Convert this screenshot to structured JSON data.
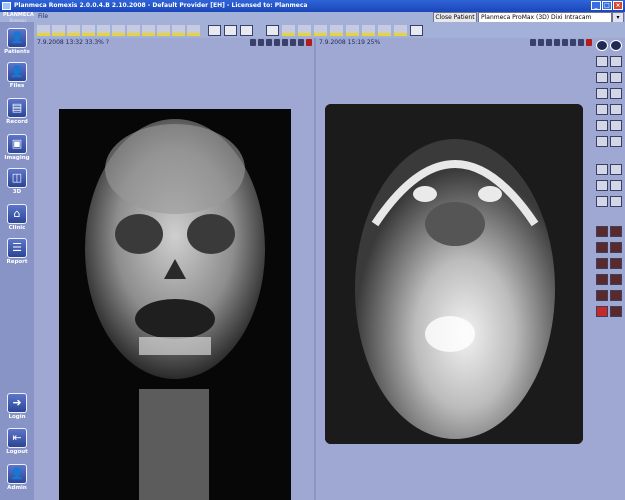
{
  "window": {
    "title": "Planmeca Romexis 2.0.0.4.B 2.10.2008 - Default Provider [EH] - Licensed to: Planmeca"
  },
  "menu": {
    "file_label": "File"
  },
  "brand": {
    "line1": "PLANMECA",
    "line2": "Romexis"
  },
  "patient_bar": {
    "close_patient_label": "Close Patient",
    "device_selected": "Planmeca ProMax (3D) Dixi Intracam"
  },
  "nav": {
    "items": [
      {
        "label": "Patients",
        "icon": "patients-icon"
      },
      {
        "label": "Files",
        "icon": "files-icon"
      },
      {
        "label": "Record",
        "icon": "record-icon"
      },
      {
        "label": "Imaging",
        "icon": "imaging-icon"
      },
      {
        "label": "3D",
        "icon": "3d-icon"
      },
      {
        "label": "Clinic",
        "icon": "clinic-icon"
      },
      {
        "label": "Report",
        "icon": "report-icon"
      },
      {
        "label": "Login",
        "icon": "login-icon"
      },
      {
        "label": "Logout",
        "icon": "logout-icon"
      },
      {
        "label": "Admin",
        "icon": "admin-icon"
      }
    ]
  },
  "viewers": [
    {
      "label": "7.9.2008 13:32 33.3% ?",
      "image": "frontal-skull-xray"
    },
    {
      "label": "7.9.2008 15:19 25%",
      "image": "submentovertex-skull-xray"
    }
  ],
  "colors": {
    "titlebar": "#1f52c9",
    "workspace": "#9fa8d2",
    "nav": "#8894c6",
    "accent_yellow": "#e7d43b"
  }
}
